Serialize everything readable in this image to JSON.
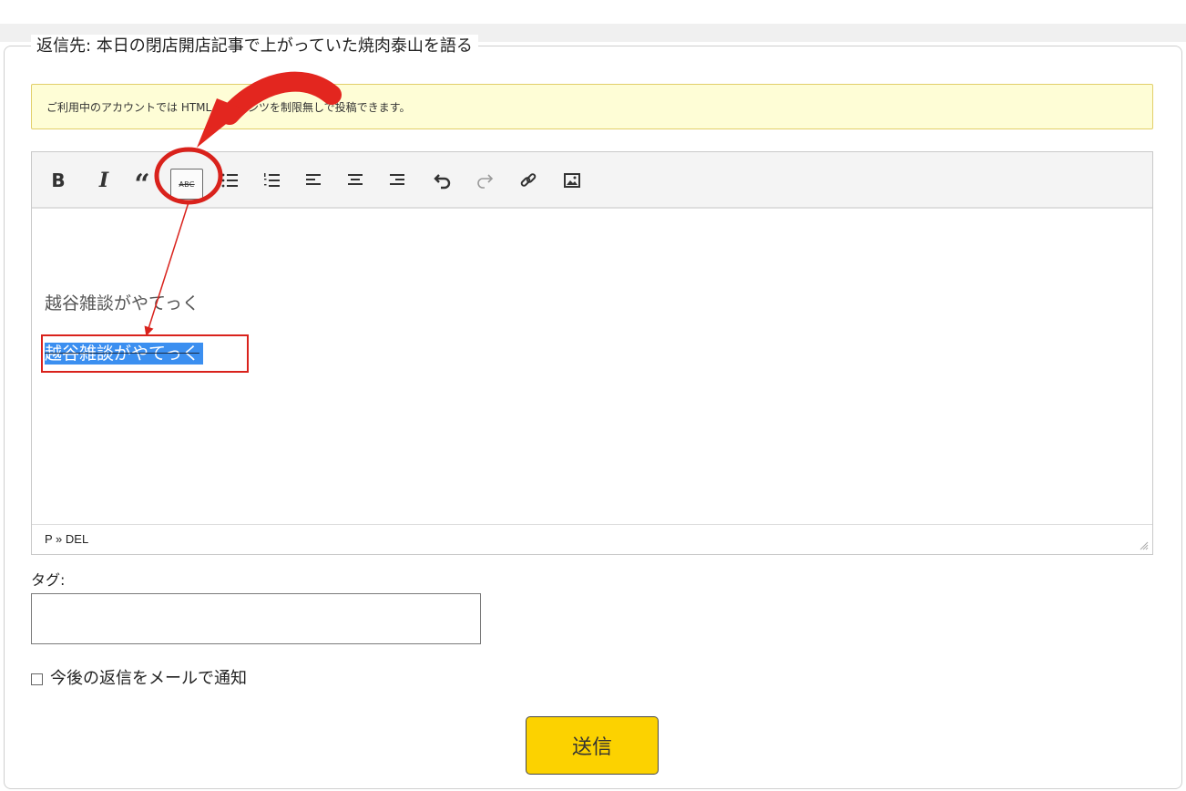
{
  "reply_section": {
    "legend": "返信先: 本日の閉店開店記事で上がっていた焼肉泰山を語る"
  },
  "notice": {
    "text": "ご利用中のアカウントでは HTML コンテンツを制限無しで投稿できます。"
  },
  "toolbar": {
    "bold": "B",
    "italic": "I",
    "quote": "“",
    "strikethrough": "ABC"
  },
  "editor": {
    "paragraph_1": "越谷雑談がやてっく",
    "paragraph_2": "越谷雑談がやてっく",
    "path": "P » DEL"
  },
  "tags": {
    "label": "タグ:",
    "value": ""
  },
  "notify": {
    "label": "今後の返信をメールで通知"
  },
  "submit": {
    "label": "送信"
  },
  "colors": {
    "submit_bg": "#fcd200",
    "notice_bg": "#fefdd6",
    "selection": "#3b8ff0",
    "annotation_red": "#d9221c"
  }
}
